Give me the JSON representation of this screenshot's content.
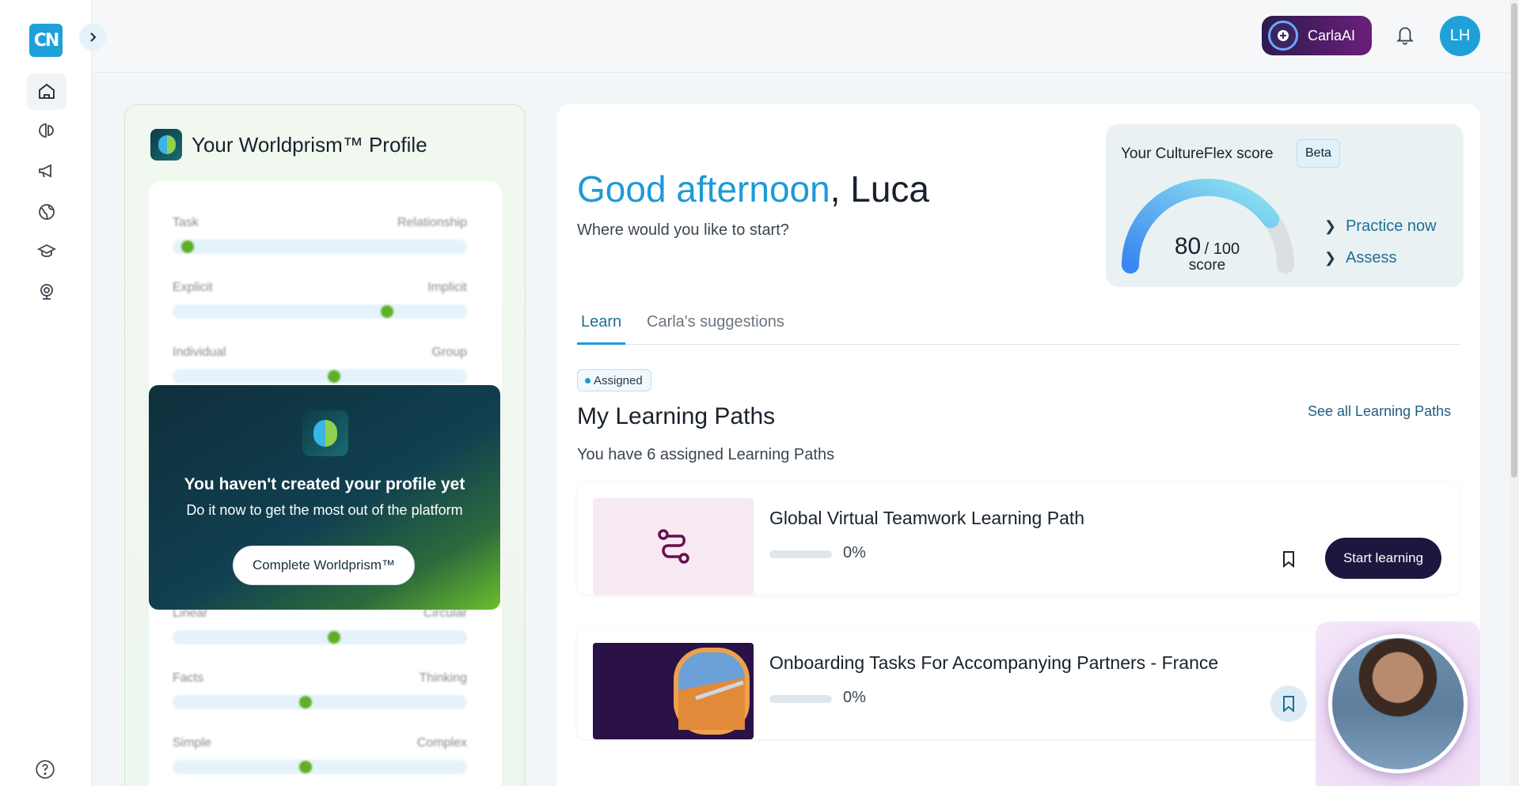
{
  "app": {
    "logo_text": "CN"
  },
  "sidebar": {
    "items": [
      {
        "icon": "home-icon",
        "label": "Home"
      },
      {
        "icon": "worldprism-icon",
        "label": "Worldprism"
      },
      {
        "icon": "megaphone-icon",
        "label": "Announcements"
      },
      {
        "icon": "globe-icon",
        "label": "Cultures"
      },
      {
        "icon": "graduation-cap-icon",
        "label": "Learning"
      },
      {
        "icon": "webcam-icon",
        "label": "Live sessions"
      }
    ],
    "help_icon": "help-icon"
  },
  "header": {
    "carla_label": "CarlaAI",
    "user_initials": "LH"
  },
  "profile": {
    "title": "Your Worldprism™ Profile",
    "dimensions": [
      {
        "left": "Task",
        "right": "Relationship",
        "value": 0.03
      },
      {
        "left": "Explicit",
        "right": "Implicit",
        "value": 0.74
      },
      {
        "left": "Individual",
        "right": "Group",
        "value": 0.55
      },
      {
        "left": "Linear",
        "right": "Circular",
        "value": 0.55
      },
      {
        "left": "Facts",
        "right": "Thinking",
        "value": 0.45
      },
      {
        "left": "Simple",
        "right": "Complex",
        "value": 0.45
      }
    ],
    "overlay": {
      "title": "You haven't created your profile yet",
      "subtitle": "Do it now to get the most out of the platform",
      "button": "Complete Worldprism™"
    }
  },
  "greeting": {
    "salutation": "Good afternoon",
    "name": ", Luca",
    "prompt": "Where would you like to start?"
  },
  "cultureflex": {
    "title": "Your CultureFlex score",
    "badge": "Beta",
    "score": "80",
    "max": "/ 100",
    "score_label": "score",
    "score_fraction": 0.8,
    "links": [
      "Practice now",
      "Assess"
    ]
  },
  "tabs": [
    {
      "label": "Learn",
      "active": true
    },
    {
      "label": "Carla's suggestions",
      "active": false
    }
  ],
  "learning_paths": {
    "badge": "Assigned",
    "title": "My Learning Paths",
    "see_all": "See all Learning Paths",
    "subtitle": "You have 6 assigned Learning Paths",
    "items": [
      {
        "name": "Global Virtual Teamwork Learning Path",
        "progress": "0%",
        "action": "Start learning"
      },
      {
        "name": "Onboarding Tasks For Accompanying Partners - France",
        "progress": "0%"
      }
    ]
  },
  "colors": {
    "brand": "#1ea0d8",
    "accent_green": "#5fae24",
    "start_button": "#1d1740"
  }
}
